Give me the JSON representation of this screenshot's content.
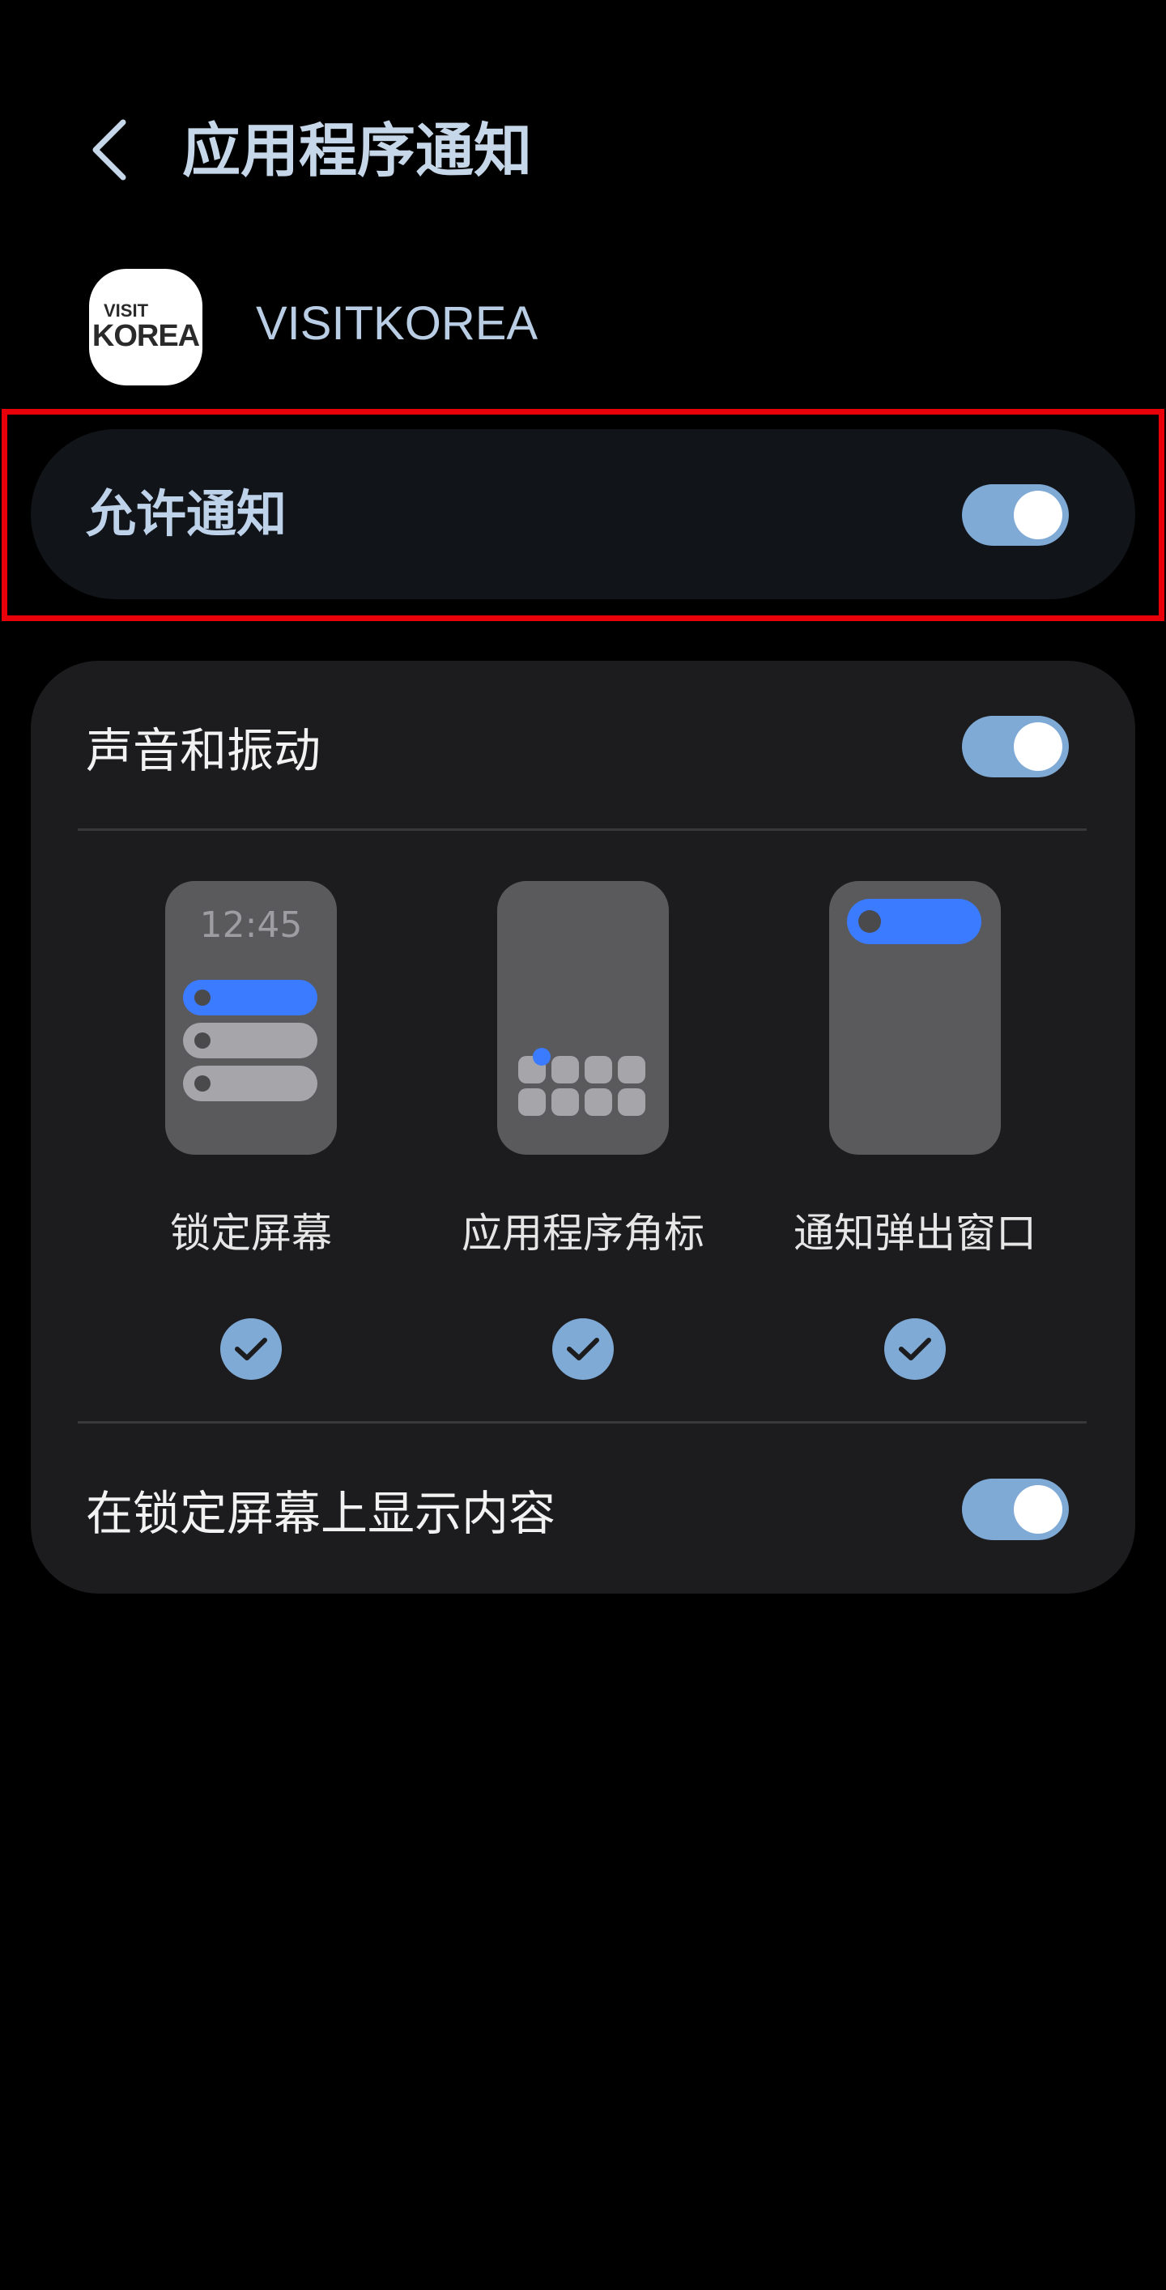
{
  "header": {
    "title": "应用程序通知",
    "back_icon": "chevron-left-icon"
  },
  "app": {
    "name": "VISITKOREA",
    "logo_line1": "VISIT",
    "logo_line2": "KOREA"
  },
  "allow_notifications": {
    "label": "允许通知",
    "enabled": true
  },
  "sound_vibration": {
    "label": "声音和振动",
    "enabled": true
  },
  "styles": [
    {
      "label": "锁定屏幕",
      "checked": true,
      "preview_time": "12:45"
    },
    {
      "label": "应用程序角标",
      "checked": true
    },
    {
      "label": "通知弹出窗口",
      "checked": true
    }
  ],
  "lock_screen_content": {
    "label": "在锁定屏幕上显示内容",
    "enabled": true
  },
  "colors": {
    "accent": "#7faad6",
    "title": "#c7d7ea",
    "highlight": "#e8000b",
    "preview_blue": "#3a7bff",
    "card_bg": "#1c1c1e"
  }
}
